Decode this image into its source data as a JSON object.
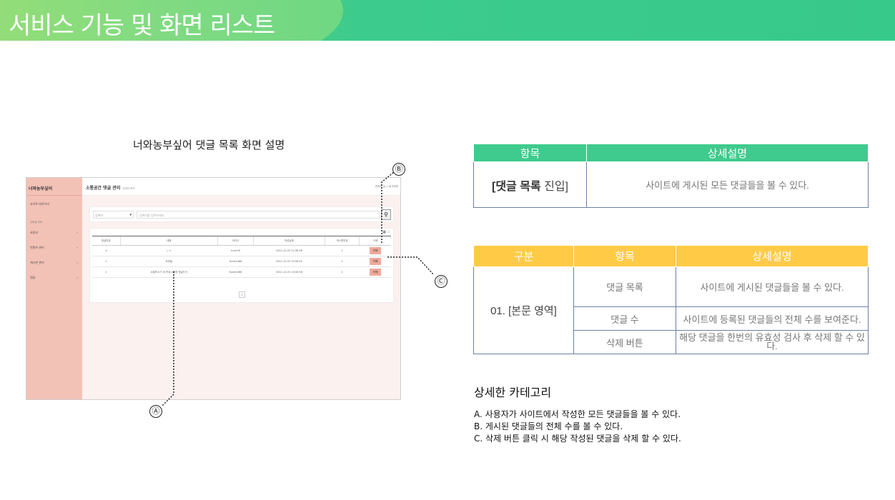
{
  "header": {
    "title": "서비스 기능 및 화면 리스트"
  },
  "mockup": {
    "caption": "너와농부싶어 댓글 목록 화면 설명",
    "brand": "너와농부싶어",
    "side_link": "사이트 바로가기",
    "side_group": "너와농 관리",
    "nav": [
      "사용자",
      "컨텐츠 관리",
      "게시판 관리",
      "댓글"
    ],
    "page_title": "소통공간 댓글 관리",
    "page_sub": "관리자 모드",
    "user_info": "관리자 님 ○ 로그아웃",
    "search_select": "검색어",
    "search_placeholder": "검색어를 입력하세요",
    "columns": [
      "댓글번호",
      "내용",
      "아이디",
      "작성날짜",
      "게시판번호",
      "삭제"
    ],
    "rows": [
      [
        "4",
        "ㄴㅇ",
        "hnez39",
        "2022-10-20 22:38:56",
        "1",
        "삭제"
      ],
      [
        "2",
        "조조들",
        "fsxdr4488",
        "2022-10-25 10:08:55",
        "1",
        "삭제"
      ],
      [
        "1",
        "소통하시기 내 커뮤니티에 댓글쓰기",
        "fsxdr4488",
        "2022-10-25 10:08:58",
        "1",
        "삭제"
      ]
    ],
    "page_no": "1",
    "callouts": {
      "a": "Ⓐ",
      "b": "Ⓑ",
      "c": "Ⓒ"
    }
  },
  "table1": {
    "headers": [
      "항목",
      "상세설명"
    ],
    "key_bold": "[댓글 목록",
    "key_rest": " 진입]",
    "desc": "사이트에 게시된 모든 댓글들을 볼 수 있다."
  },
  "table2": {
    "headers": [
      "구분",
      "항목",
      "상세설명"
    ],
    "group": "01. [본문 영역]",
    "rows": [
      {
        "item": "댓글 목록",
        "desc": "사이트에 게시된 댓글들을 볼 수 있다."
      },
      {
        "item": "댓글 수",
        "desc": "사이트에 등록된 댓글들의 전체 수를 보여준다."
      },
      {
        "item": "삭제 버튼",
        "desc": "해당 댓글을 한번의 유효성 검사 후 삭제 할 수 있다."
      }
    ]
  },
  "categories": {
    "title": "상세한 카테고리",
    "items": [
      "A. 사용자가 사이트에서 작성한 모든 댓글들을 볼 수 있다.",
      "B. 게시된 댓글들의 전체 수를 볼 수 있다.",
      "C. 삭제 버튼 클릭 시 해당 작성된 댓글을 삭제 할 수 있다."
    ]
  }
}
